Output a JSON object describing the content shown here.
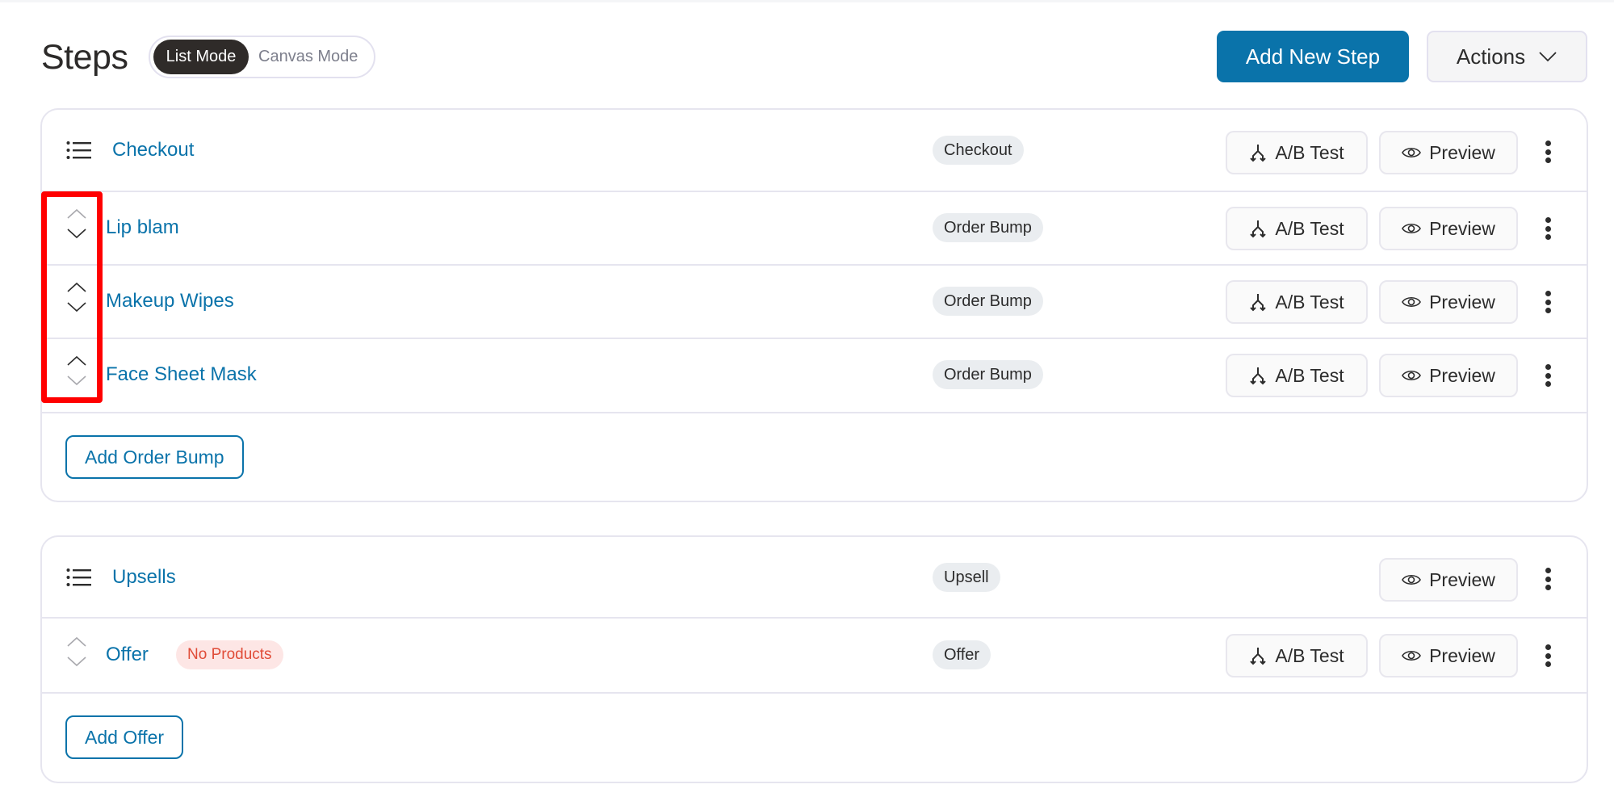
{
  "header": {
    "title": "Steps",
    "modes": [
      {
        "label": "List Mode",
        "active": true
      },
      {
        "label": "Canvas Mode",
        "active": false
      }
    ],
    "add_step_label": "Add New Step",
    "actions_label": "Actions"
  },
  "groups": [
    {
      "title": "Checkout",
      "type_badge": "Checkout",
      "has_ab_test": true,
      "ab_test_label": "A/B Test",
      "preview_label": "Preview",
      "items": [
        {
          "title": "Lip blam",
          "type_badge": "Order Bump",
          "ab_test_label": "A/B Test",
          "preview_label": "Preview",
          "up_disabled": true,
          "down_disabled": false
        },
        {
          "title": "Makeup Wipes",
          "type_badge": "Order Bump",
          "ab_test_label": "A/B Test",
          "preview_label": "Preview",
          "up_disabled": false,
          "down_disabled": false
        },
        {
          "title": "Face Sheet Mask",
          "type_badge": "Order Bump",
          "ab_test_label": "A/B Test",
          "preview_label": "Preview",
          "up_disabled": false,
          "down_disabled": true
        }
      ],
      "add_label": "Add Order Bump"
    },
    {
      "title": "Upsells",
      "type_badge": "Upsell",
      "has_ab_test": false,
      "preview_label": "Preview",
      "items": [
        {
          "title": "Offer",
          "warning_badge": "No Products",
          "type_badge": "Offer",
          "ab_test_label": "A/B Test",
          "preview_label": "Preview",
          "up_disabled": true,
          "down_disabled": true
        }
      ],
      "add_label": "Add Offer"
    }
  ],
  "icons": {
    "group": "list-icon",
    "ab_test": "split-arrows-icon",
    "preview": "eye-icon",
    "more": "kebab-menu-icon",
    "move_up": "chevron-up-icon",
    "move_down": "chevron-down-icon",
    "dropdown": "chevron-down-icon"
  },
  "colors": {
    "primary": "#0a73aa",
    "warning_text": "#e04c38",
    "warning_bg": "#fde6e5",
    "badge_bg": "#eaedf0",
    "highlight": "#ff0000"
  }
}
